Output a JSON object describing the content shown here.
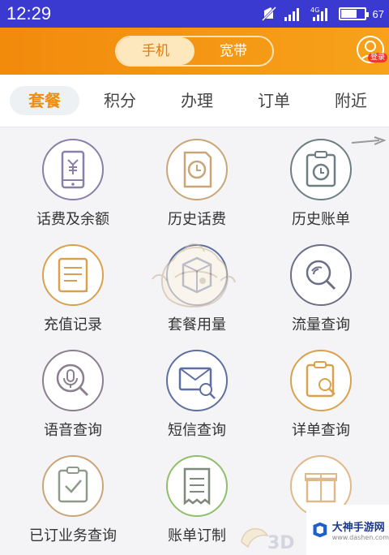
{
  "status_bar": {
    "time": "12:29",
    "battery_text": "67",
    "battery_level": 0.67,
    "icons": [
      "no-sim-icon",
      "signal-icon",
      "signal-4g-icon",
      "battery-icon"
    ]
  },
  "top_bar": {
    "segments": [
      {
        "label": "手机",
        "active": true
      },
      {
        "label": "宽带",
        "active": false
      }
    ],
    "avatar_badge": "登录"
  },
  "tabs": [
    {
      "label": "套餐",
      "active": true
    },
    {
      "label": "积分",
      "active": false
    },
    {
      "label": "办理",
      "active": false
    },
    {
      "label": "订单",
      "active": false
    },
    {
      "label": "附近",
      "active": false
    }
  ],
  "grid": [
    {
      "label": "话费及余额",
      "icon": "phone-balance-icon"
    },
    {
      "label": "历史话费",
      "icon": "history-fee-icon"
    },
    {
      "label": "历史账单",
      "icon": "history-bill-icon"
    },
    {
      "label": "充值记录",
      "icon": "recharge-record-icon"
    },
    {
      "label": "套餐用量",
      "icon": "package-usage-icon"
    },
    {
      "label": "流量查询",
      "icon": "data-query-icon"
    },
    {
      "label": "语音查询",
      "icon": "voice-query-icon"
    },
    {
      "label": "短信查询",
      "icon": "sms-query-icon"
    },
    {
      "label": "详单查询",
      "icon": "detail-query-icon"
    },
    {
      "label": "已订业务查询",
      "icon": "subscribed-service-icon"
    },
    {
      "label": "账单订制",
      "icon": "bill-custom-icon"
    },
    {
      "label": "",
      "icon": "gift-icon"
    }
  ],
  "watermark": {
    "text": "3D",
    "brand_name": "大神手游网",
    "brand_url": "www.dashen.com"
  },
  "colors": {
    "status_bar": "#3a3ad0",
    "header_orange": "#f28a0c",
    "accent": "#f08c10",
    "icon_purple": "#8a7fa8",
    "icon_orange": "#d9a14e",
    "icon_green": "#8fbf6a",
    "icon_blue": "#5e6fa0"
  }
}
